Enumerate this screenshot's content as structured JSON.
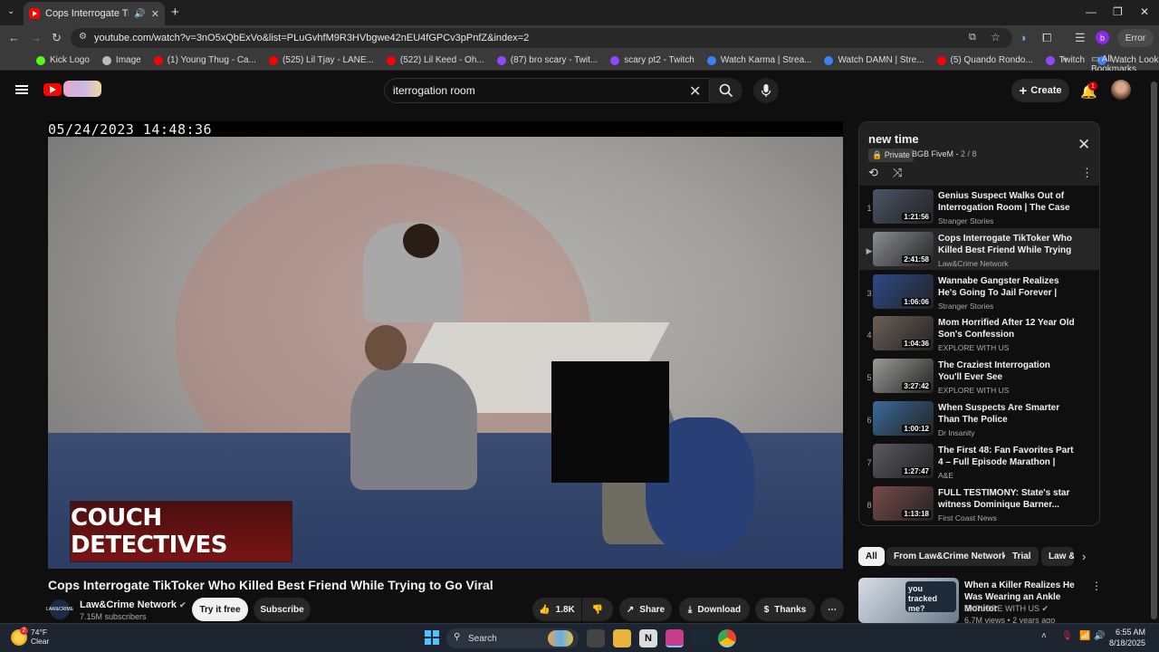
{
  "browser": {
    "tab_title": "Cops Interrogate TikToker W",
    "url": "youtube.com/watch?v=3nO5xQbExVo&list=PLuGvhfM9R3HVbgwe42nEU4fGPCv3pPnfZ&index=2",
    "error_label": "Error",
    "profile_letter": "b",
    "bookmarks": [
      {
        "label": "Kick Logo",
        "color": "#53fc18"
      },
      {
        "label": "Image",
        "color": "#bbbbbb"
      },
      {
        "label": "(1) Young Thug - Ca...",
        "color": "#ff0000"
      },
      {
        "label": "(525) Lil Tjay - LANE...",
        "color": "#ff0000"
      },
      {
        "label": "(522) Lil Keed - Oh...",
        "color": "#ff0000"
      },
      {
        "label": "(87) bro scary - Twit...",
        "color": "#9146ff"
      },
      {
        "label": "scary pt2 - Twitch",
        "color": "#9146ff"
      },
      {
        "label": "Watch Karma | Strea...",
        "color": "#3b82f6"
      },
      {
        "label": "Watch DAMN | Stre...",
        "color": "#3b82f6"
      },
      {
        "label": "(5) Quando Rondo...",
        "color": "#ff0000"
      },
      {
        "label": "Twitch",
        "color": "#9146ff"
      },
      {
        "label": "Watch Look im sorr...",
        "color": "#3b82f6"
      }
    ],
    "all_bookmarks": "All Bookmarks"
  },
  "header": {
    "search_value": "iterrogation room",
    "create_label": "Create",
    "notif_count": "1"
  },
  "video": {
    "timestamp": "05/24/2023 14:48:36",
    "overlay_text": "COUCH DETECTIVES",
    "title": "Cops Interrogate TikToker Who Killed Best Friend While Trying to Go Viral",
    "channel": "Law&Crime Network",
    "channel_logo_text": "LAW&CRIME",
    "subscribers": "7.15M subscribers",
    "try_label": "Try it free",
    "subscribe_label": "Subscribe",
    "likes": "1.8K",
    "share_label": "Share",
    "download_label": "Download",
    "thanks_label": "Thanks"
  },
  "playlist": {
    "title": "new time",
    "privacy": "Private",
    "owner": "BGB FiveM",
    "position": "2 / 8",
    "items": [
      {
        "num": "1",
        "title": "Genius Suspect Walks Out of Interrogation Room | The Case o...",
        "channel": "Stranger Stories",
        "duration": "1:21:56",
        "thumb": "#4a5566"
      },
      {
        "num": "▶",
        "title": "Cops Interrogate TikToker Who Killed Best Friend While Trying t...",
        "channel": "Law&Crime Network",
        "duration": "2:41:58",
        "thumb": "#8a8e92"
      },
      {
        "num": "3",
        "title": "Wannabe Gangster Realizes He's Going To Jail Forever | The...",
        "channel": "Stranger Stories",
        "duration": "1:06:06",
        "thumb": "#2d4a8a"
      },
      {
        "num": "4",
        "title": "Mom Horrified After 12 Year Old Son's Confession",
        "channel": "EXPLORE WITH US",
        "duration": "1:04:36",
        "thumb": "#6a6058"
      },
      {
        "num": "5",
        "title": "The Craziest Interrogation You'll Ever See",
        "channel": "EXPLORE WITH US",
        "duration": "3:27:42",
        "thumb": "#9a9a96"
      },
      {
        "num": "6",
        "title": "When Suspects Are Smarter Than The Police",
        "channel": "Dr Insanity",
        "duration": "1:00:12",
        "thumb": "#3a6a9a"
      },
      {
        "num": "7",
        "title": "The First 48: Fan Favorites Part 4 – Full Episode Marathon | A&E",
        "channel": "A&E",
        "duration": "1:27:47",
        "thumb": "#5a5a60"
      },
      {
        "num": "8",
        "title": "FULL TESTIMONY: State's star witness Dominique Barner...",
        "channel": "First Coast News",
        "duration": "1:13:18",
        "thumb": "#7a4a4a"
      }
    ]
  },
  "chips": [
    "All",
    "From Law&Crime Network",
    "Trial",
    "Law &"
  ],
  "recommendation": {
    "title": "When a Killer Realizes He Was Wearing an Ankle Monitor",
    "channel": "EXPLORE WITH US",
    "meta": "6.7M views • 2 years ago",
    "thumb_text": "you tracked me?"
  },
  "taskbar": {
    "temp": "74°F",
    "condition": "Clear",
    "weather_badge": "2",
    "search_label": "Search",
    "time": "6:55 AM",
    "date": "8/18/2025"
  }
}
